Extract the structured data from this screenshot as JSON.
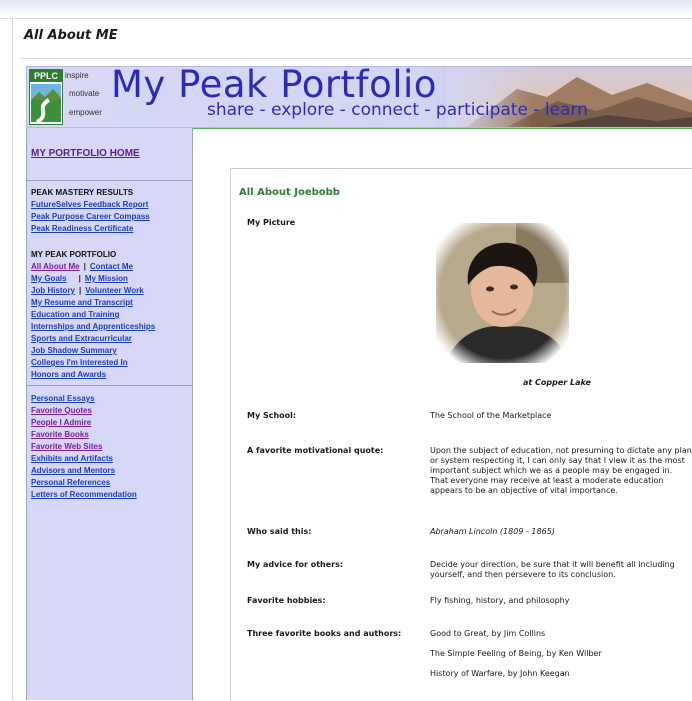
{
  "page": {
    "heading": "All About ME"
  },
  "banner": {
    "logo": "PPLC",
    "taglines": [
      "inspire",
      "motivate",
      "empower"
    ],
    "title": "My Peak Portfolio",
    "subtitle": "share - explore - connect - participate - learn"
  },
  "sidebar": {
    "home": "MY PORTFOLIO HOME",
    "mastery_heading": "PEAK MASTERY RESULTS",
    "mastery_links": [
      "FutureSelves Feedback Report",
      "Peak Purpose Career Compass",
      "Peak Readiness Certificate"
    ],
    "portfolio_heading": "MY PEAK PORTFOLIO",
    "pairs": [
      [
        "All About Me",
        "Contact Me"
      ],
      [
        "My Goals",
        "My Mission"
      ],
      [
        "Job History",
        "Volunteer Work"
      ]
    ],
    "portfolio_links": [
      "My Resume and Transcript",
      "Education and Training",
      "Internships and Apprenticeships",
      "Sports and Extracurricular",
      "Job Shadow Summary",
      "Colleges I'm Interested In",
      "Honors and Awards"
    ],
    "extra_links": [
      "Personal Essays",
      "Favorite Quotes",
      "People I Admire",
      "Favorite Books",
      "Favorite Web Sites",
      "Exhibits and Artifacts",
      "Advisors and Mentors",
      "Personal References",
      "Letters of Recommendation"
    ]
  },
  "content": {
    "title": "All About Joebobb",
    "picture_label": "My Picture",
    "picture_caption": "at Copper Lake",
    "school_label": "My School:",
    "school_value": "The School of the Marketplace",
    "quote_label": "A favorite motivational quote:",
    "quote_value": "Upon the subject of education, not presuming to dictate any plan or system respecting it, I can only say that I view it as the most important subject which we as a people may be engaged in. That everyone may receive at least a moderate education appears to be an objective of vital importance.",
    "said_label": "Who said this:",
    "said_value": "Abraham Lincoln (1809 - 1865)",
    "advice_label": "My advice for others:",
    "advice_value": "Decide your direction, be sure that it will benefit all including yourself, and then persevere to its conclusion.",
    "hobbies_label": "Favorite hobbies:",
    "hobbies_value": "Fly fishing, history, and philosophy",
    "books_label": "Three favorite books and authors:",
    "books": [
      "Good to Great, by Jim Collins",
      "The Simple Feeling of Being, by Ken Wilber",
      "History of Warfare, by John Keegan"
    ]
  },
  "colors": {
    "brand_blue": "#2b2bb8",
    "sidebar_bg": "#d7d7f7",
    "title_green": "#2e7d32",
    "link_blue": "#1b3fc0",
    "visited_purple": "#7a1fa0"
  }
}
